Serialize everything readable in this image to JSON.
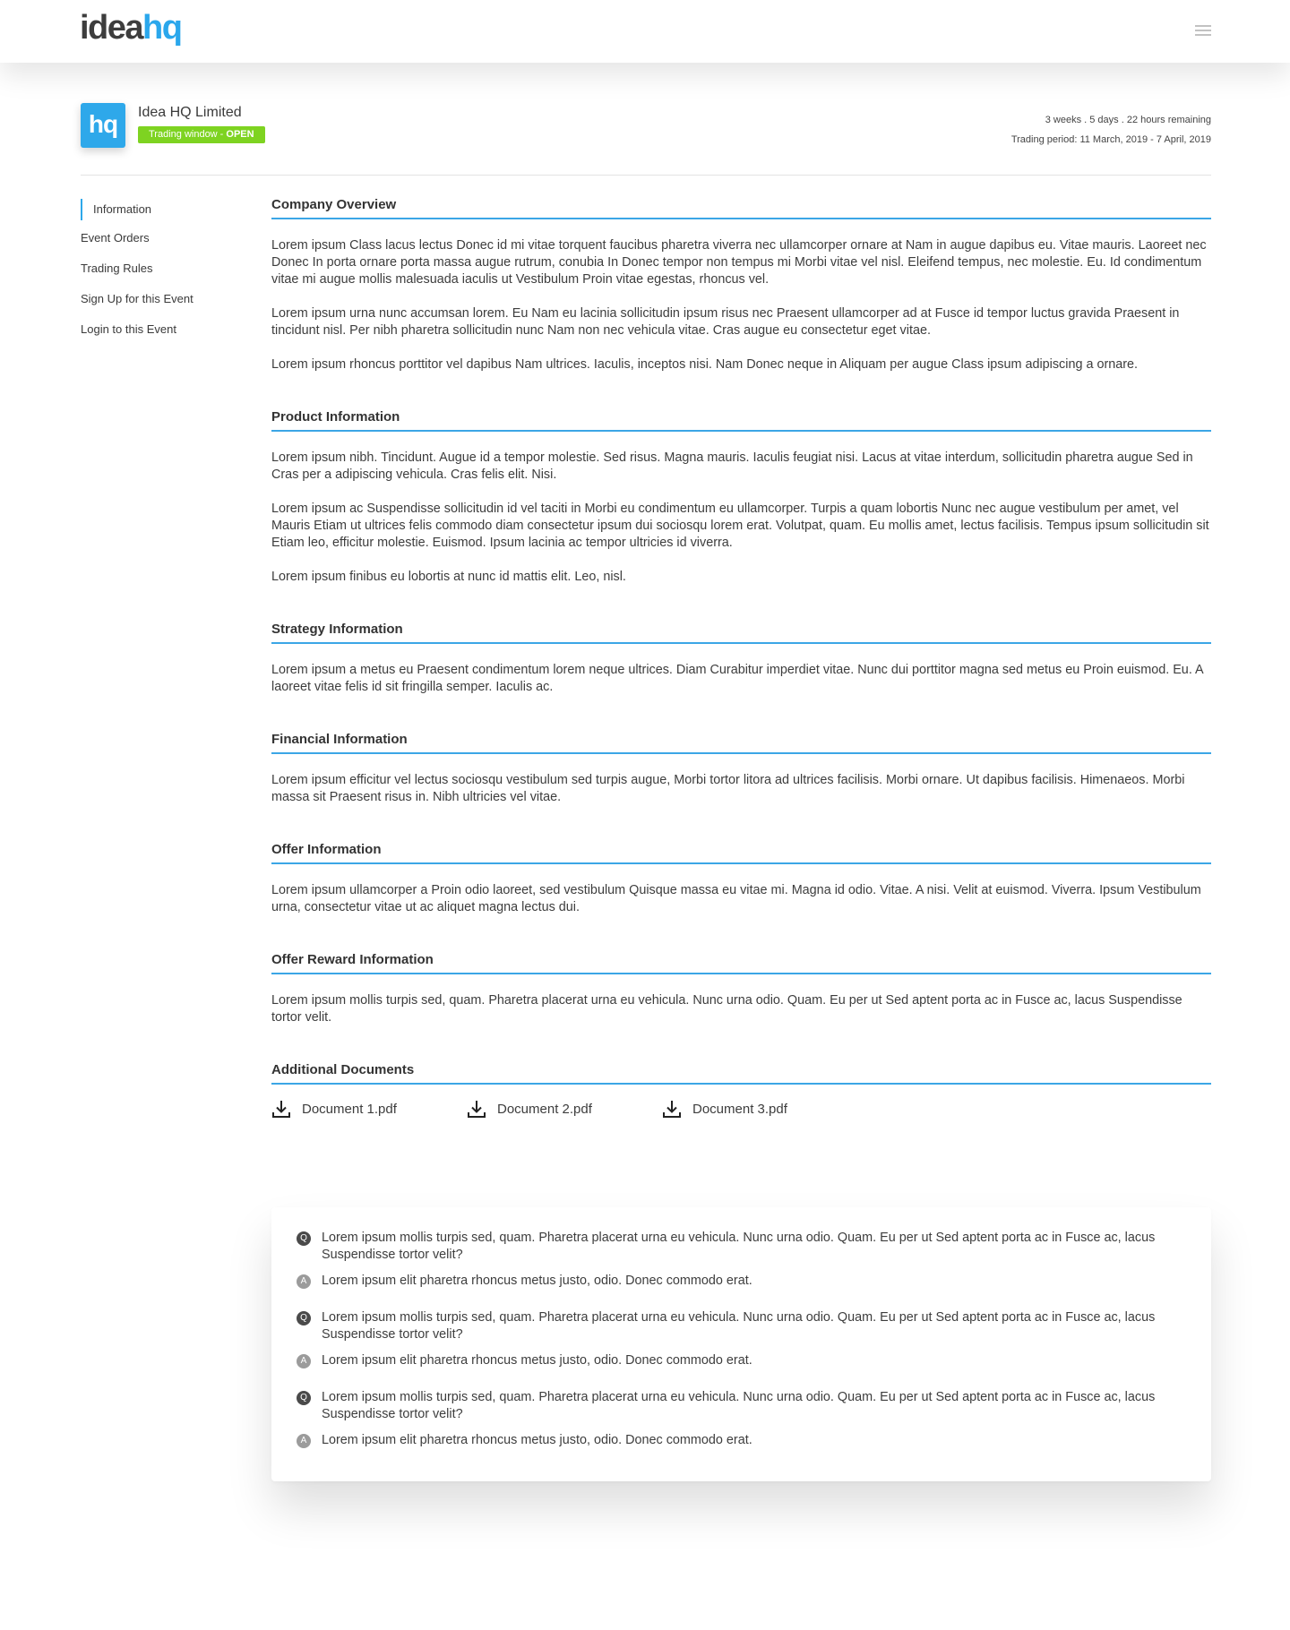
{
  "header": {
    "logo_part1": "idea",
    "logo_part2": "hq",
    "menu_icon": "hamburger-menu-icon"
  },
  "company": {
    "logo_text": "hq",
    "name": "Idea HQ Limited",
    "status_prefix": "Trading window - ",
    "status_value": "OPEN",
    "remaining": "3 weeks . 5 days . 22 hours remaining",
    "trading_period": "Trading period: 11 March, 2019 - 7 April, 2019"
  },
  "colors": {
    "accent": "#2ea8ea",
    "status_open": "#7ed321"
  },
  "sidebar": {
    "items": [
      {
        "label": "Information",
        "active": true
      },
      {
        "label": "Event Orders"
      },
      {
        "label": "Trading Rules"
      },
      {
        "label": "Sign Up for this Event"
      },
      {
        "label": "Login to this Event"
      }
    ]
  },
  "sections": [
    {
      "title": "Company Overview",
      "paragraphs": [
        "Lorem ipsum Class lacus lectus Donec id mi vitae torquent faucibus pharetra viverra nec ullamcorper ornare at Nam in augue dapibus eu. Vitae mauris. Laoreet nec Donec In porta ornare porta massa augue rutrum, conubia In Donec tempor non tempus mi Morbi vitae vel nisl. Eleifend tempus, nec molestie. Eu. Id condimentum vitae mi augue mollis malesuada iaculis ut Vestibulum Proin vitae egestas, rhoncus vel.",
        "Lorem ipsum urna nunc accumsan lorem. Eu Nam eu lacinia sollicitudin ipsum risus nec Praesent ullamcorper ad at Fusce id tempor luctus gravida Praesent in tincidunt nisl. Per nibh pharetra sollicitudin nunc Nam non nec vehicula vitae. Cras augue eu consectetur eget vitae.",
        "Lorem ipsum rhoncus porttitor vel dapibus Nam ultrices. Iaculis, inceptos nisi. Nam Donec neque in Aliquam per augue Class ipsum adipiscing a ornare."
      ]
    },
    {
      "title": "Product Information",
      "paragraphs": [
        "Lorem ipsum nibh. Tincidunt. Augue id a tempor molestie. Sed risus. Magna mauris. Iaculis feugiat nisi. Lacus at vitae interdum, sollicitudin pharetra augue Sed in Cras per a adipiscing vehicula. Cras felis elit. Nisi.",
        "Lorem ipsum ac Suspendisse sollicitudin id vel taciti in Morbi eu condimentum eu ullamcorper. Turpis a quam lobortis Nunc nec augue vestibulum per amet, vel Mauris Etiam ut ultrices felis commodo diam consectetur ipsum dui sociosqu lorem erat. Volutpat, quam. Eu mollis amet, lectus facilisis. Tempus ipsum sollicitudin sit Etiam leo, efficitur molestie. Euismod. Ipsum lacinia ac tempor ultricies id viverra.",
        "Lorem ipsum finibus eu lobortis at nunc id mattis elit. Leo, nisl."
      ]
    },
    {
      "title": "Strategy Information",
      "paragraphs": [
        "Lorem ipsum a metus eu Praesent condimentum lorem neque ultrices. Diam Curabitur imperdiet vitae. Nunc dui porttitor magna sed metus eu Proin euismod. Eu. A laoreet vitae felis id sit fringilla semper. Iaculis ac."
      ]
    },
    {
      "title": "Financial Information",
      "paragraphs": [
        "Lorem ipsum efficitur vel lectus sociosqu vestibulum sed turpis augue, Morbi tortor litora ad ultrices facilisis. Morbi ornare. Ut dapibus facilisis. Himenaeos. Morbi massa sit Praesent risus in. Nibh ultricies vel vitae."
      ]
    },
    {
      "title": "Offer Information",
      "paragraphs": [
        "Lorem ipsum ullamcorper a Proin odio laoreet, sed vestibulum Quisque massa eu vitae mi. Magna id odio. Vitae. A nisi. Velit at euismod. Viverra. Ipsum Vestibulum urna, consectetur vitae ut ac aliquet magna lectus dui."
      ]
    },
    {
      "title": "Offer Reward Information",
      "paragraphs": [
        "Lorem ipsum mollis turpis sed, quam. Pharetra placerat urna eu vehicula. Nunc urna odio. Quam. Eu per ut Sed aptent porta ac in Fusce ac, lacus Suspendisse tortor velit."
      ]
    }
  ],
  "documents": {
    "title": "Additional Documents",
    "items": [
      {
        "name": "Document 1.pdf",
        "icon": "download-icon"
      },
      {
        "name": "Document 2.pdf",
        "icon": "download-icon"
      },
      {
        "name": "Document 3.pdf",
        "icon": "download-icon"
      }
    ]
  },
  "faq": {
    "q_label": "Q",
    "a_label": "A",
    "items": [
      {
        "question": "Lorem ipsum mollis turpis sed, quam. Pharetra placerat urna eu vehicula. Nunc urna odio. Quam. Eu per ut Sed aptent porta ac in Fusce ac, lacus Suspendisse tortor velit?",
        "answer": "Lorem ipsum elit pharetra rhoncus metus justo, odio. Donec commodo erat."
      },
      {
        "question": "Lorem ipsum mollis turpis sed, quam. Pharetra placerat urna eu vehicula. Nunc urna odio. Quam. Eu per ut Sed aptent porta ac in Fusce ac, lacus Suspendisse tortor velit?",
        "answer": "Lorem ipsum elit pharetra rhoncus metus justo, odio. Donec commodo erat."
      },
      {
        "question": "Lorem ipsum mollis turpis sed, quam. Pharetra placerat urna eu vehicula. Nunc urna odio. Quam. Eu per ut Sed aptent porta ac in Fusce ac, lacus Suspendisse tortor velit?",
        "answer": "Lorem ipsum elit pharetra rhoncus metus justo, odio. Donec commodo erat."
      }
    ]
  }
}
